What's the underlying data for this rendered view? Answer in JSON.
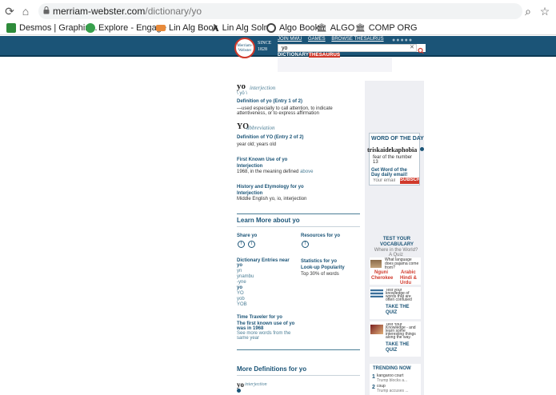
{
  "browser": {
    "url_host": "merriam-webster.com",
    "url_path": "/dictionary/yo",
    "bookmarks": [
      {
        "label": "Desmos | Graphin...",
        "color": "#2e8b3a"
      },
      {
        "label": "Explore - Engage",
        "color": "#37a04c"
      },
      {
        "label": "Lin Alg Book",
        "color": "#e88a3a"
      },
      {
        "label": "Lin Alg Soln",
        "color": "#222222"
      },
      {
        "label": "Algo Book",
        "color": "#444444"
      },
      {
        "label": "ALGO",
        "color": "#555555"
      },
      {
        "label": "COMP ORG",
        "color": "#555555"
      }
    ]
  },
  "header": {
    "logo_line1": "Merriam-",
    "logo_line2": "Webster",
    "since": "SINCE",
    "year": "1828",
    "nav": [
      "JOIN MWU",
      "GAMES",
      "BROWSE THESAURUS"
    ],
    "search_value": "yo",
    "tab_dictionary": "DICTIONARY",
    "tab_thesaurus": "THESAURUS"
  },
  "entry1": {
    "headword": "yo",
    "fl": "interjection",
    "pron": "\\ yō \\",
    "def_heading": "Definition of yo (Entry 1 of 2)",
    "def_text": "—used especially to call attention, to indicate attentiveness, or to express affirmation"
  },
  "entry2": {
    "headword": "YO",
    "fl": "abbreviation",
    "def_heading": "Definition of YO (Entry 2 of 2)",
    "def_text": "year old; years old"
  },
  "first_known": {
    "heading": "First Known Use of yo",
    "sub": "Interjection",
    "text": "1968, in the meaning defined",
    "link": "above"
  },
  "etymology": {
    "heading": "History and Etymology for yo",
    "sub": "Interjection",
    "text": "Middle English yo, io, interjection"
  },
  "learn_more": {
    "heading": "Learn More about yo",
    "share": "Share yo",
    "resources": "Resources for yo",
    "entries_heading": "Dictionary Entries near yo",
    "entries": [
      "yn",
      "ynambu",
      "-yne",
      "yo",
      "YO",
      "yob",
      "YOB"
    ],
    "stats_heading": "Statistics for yo",
    "popularity_heading": "Look-up Popularity",
    "popularity": "Top 30% of words",
    "time_heading": "Time Traveler for yo",
    "time_link": "The first known use of yo was in 1968",
    "time_more": "See more words from the same year"
  },
  "more_defs": {
    "heading": "More Definitions for yo",
    "headword": "yo",
    "fl": "interjection"
  },
  "sidebar": {
    "wotd_title": "WORD OF THE DAY",
    "wotd_word": "triskaidekaphobia",
    "wotd_def": "fear of the number 13",
    "wotd_cta": "Get Word of the Day daily email!",
    "email_placeholder": "Your email",
    "subscribe": "SUBSCRIBE",
    "vocab_title": "TEST YOUR VOCABULARY",
    "quiz1_q": "Where in the World? A Quiz",
    "quiz1_sub": "What language does pajama come from?",
    "quiz1_a": "Nguni",
    "quiz1_b": "Arabic",
    "quiz1_c": "Cherokee",
    "quiz1_d": "Hindi & Urdu",
    "quiz2_text": "Test your knowledge of words that are often confused",
    "quiz2_cta": "TAKE THE QUIZ",
    "quiz3_text": "Test Your Knowledge - and learn some interesting things along the way.",
    "quiz3_cta": "TAKE THE QUIZ",
    "trending_title": "TRENDING NOW",
    "trend1_num": "1",
    "trend1_word": "kangaroo court",
    "trend1_sub": "Trump blocks a...",
    "trend2_num": "2",
    "trend2_word": "coup",
    "trend2_sub": "Trump accuses ..."
  }
}
